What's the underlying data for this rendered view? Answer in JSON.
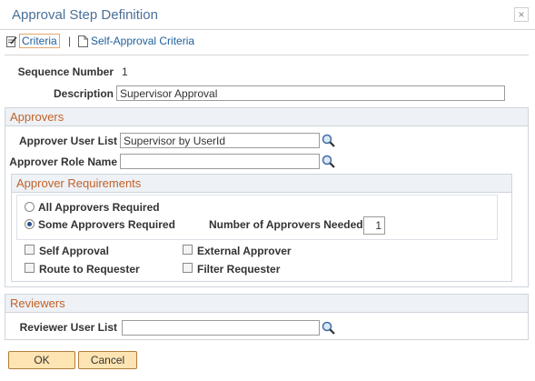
{
  "window": {
    "title": "Approval Step Definition",
    "close": "×"
  },
  "tabs": [
    {
      "label": "Criteria"
    },
    {
      "label": "Self-Approval Criteria"
    }
  ],
  "tab_separator": "|",
  "sequence": {
    "label": "Sequence Number",
    "value": "1"
  },
  "description": {
    "label": "Description",
    "value": "Supervisor Approval"
  },
  "approvers": {
    "title": "Approvers",
    "user_list": {
      "label": "Approver User List",
      "value": "Supervisor by UserId"
    },
    "role_name": {
      "label": "Approver Role Name",
      "value": ""
    },
    "requirements": {
      "title": "Approver Requirements",
      "all_required": {
        "label": "All Approvers Required",
        "checked": false
      },
      "some_required": {
        "label": "Some Approvers Required",
        "checked": true
      },
      "number_needed": {
        "label": "Number of Approvers Needed",
        "value": "1"
      },
      "self_approval": {
        "label": "Self Approval",
        "checked": false
      },
      "external_approver": {
        "label": "External Approver",
        "checked": false
      },
      "route_to_requester": {
        "label": "Route to Requester",
        "checked": false
      },
      "filter_requester": {
        "label": "Filter Requester",
        "checked": false
      }
    }
  },
  "reviewers": {
    "title": "Reviewers",
    "user_list": {
      "label": "Reviewer User List",
      "value": ""
    }
  },
  "buttons": {
    "ok": "OK",
    "cancel": "Cancel"
  },
  "colors": {
    "title": "#4a6f97",
    "section_title": "#c0622a",
    "link": "#1e5f9d",
    "button_bg": "#fde4b2"
  }
}
